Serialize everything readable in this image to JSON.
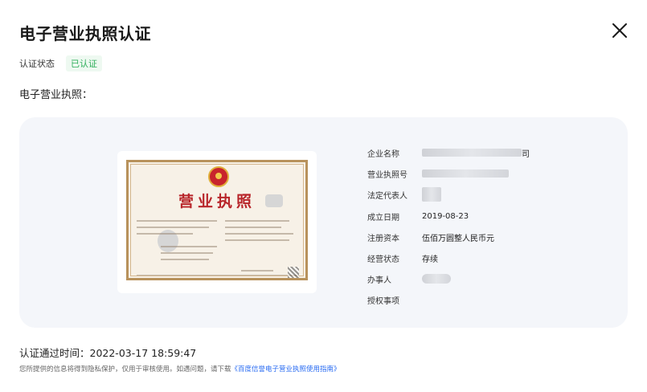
{
  "dialog": {
    "title": "电子营业执照认证"
  },
  "status": {
    "label": "认证状态",
    "badge": "已认证",
    "badge_color": "#2fae5b"
  },
  "section": {
    "label": "电子营业执照："
  },
  "license_image": {
    "title": "营业执照",
    "emblem": "national-emblem-icon"
  },
  "info": {
    "rows": [
      {
        "label": "企业名称",
        "value": "司",
        "masked": true
      },
      {
        "label": "营业执照号",
        "value": "",
        "masked": true
      },
      {
        "label": "法定代表人",
        "value": "",
        "masked": true
      },
      {
        "label": "成立日期",
        "value": "2019-08-23",
        "masked": false
      },
      {
        "label": "注册资本",
        "value": "伍佰万圆整人民币元",
        "masked": false
      },
      {
        "label": "经营状态",
        "value": "存续",
        "masked": false
      },
      {
        "label": "办事人",
        "value": "",
        "masked": true
      },
      {
        "label": "授权事项",
        "value": "",
        "masked": false
      }
    ]
  },
  "footer": {
    "pass_time": "认证通过时间：2022-03-17 18:59:47",
    "note_prefix": "您所提供的信息将得到隐私保护，仅用于审核使用。如遇问题，请下载",
    "note_link": "《百度信誉电子营业执照使用指南》",
    "link_color": "#2468f2"
  },
  "icons": {
    "close": "close-icon"
  }
}
